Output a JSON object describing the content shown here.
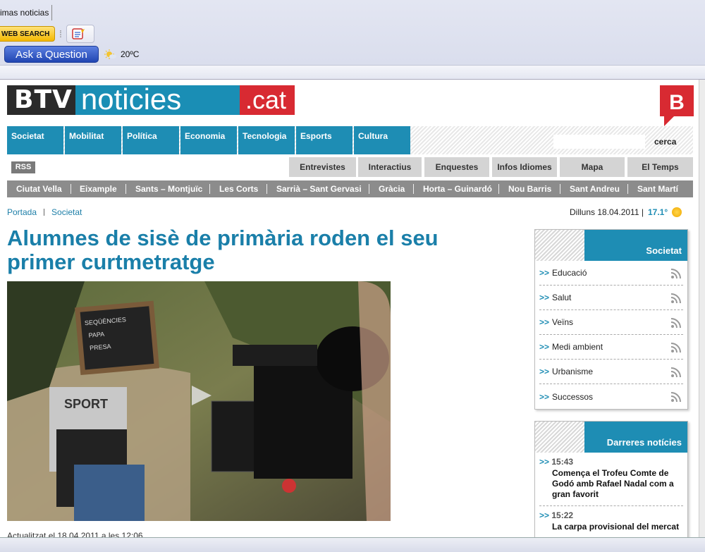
{
  "chrome": {
    "tab_label": "imas noticias",
    "web_search_label": "WEB SEARCH",
    "ask_label": "Ask a Question",
    "weather": "20ºC"
  },
  "header": {
    "logo_btv": "BTV",
    "logo_noticies": "noticies",
    "logo_cat": ".cat",
    "b_logo": "B"
  },
  "nav": {
    "items": [
      "Societat",
      "Mobilitat",
      "Política",
      "Economia",
      "Tecnologia",
      "Esports",
      "Cultura"
    ],
    "search_label": "cerca"
  },
  "subnav": {
    "rss": "RSS",
    "items": [
      "Entrevistes",
      "Interactius",
      "Enquestes",
      "Infos Idiomes",
      "Mapa",
      "El Temps"
    ]
  },
  "districts": [
    "Ciutat Vella",
    "Eixample",
    "Sants – Montjuïc",
    "Les Corts",
    "Sarrià – Sant Gervasi",
    "Gràcia",
    "Horta – Guinardó",
    "Nou Barris",
    "Sant Andreu",
    "Sant Martí"
  ],
  "breadcrumb": {
    "home": "Portada",
    "section": "Societat"
  },
  "dateline": {
    "date": "Dilluns 18.04.2011 |",
    "temp": "17.1°"
  },
  "article": {
    "headline": "Alumnes de sisè de primària roden el seu primer curtmetratge",
    "slate_text_1": "SEQÜÈNCIES",
    "slate_text_2": "PAPA",
    "slate_text_3": "PRESA",
    "shirt_text": "SPORT",
    "updated": "Actualitzat el 18.04.2011 a les 12:06"
  },
  "sidebar_societat": {
    "title": "Societat",
    "items": [
      "Educació",
      "Salut",
      "Veïns",
      "Medi ambient",
      "Urbanisme",
      "Successos"
    ]
  },
  "sidebar_news": {
    "title": "Darreres notícies",
    "items": [
      {
        "time": "15:43",
        "title": "Comença el Trofeu Comte de Godó amb Rafael Nadal com a gran favorit"
      },
      {
        "time": "15:22",
        "title": "La carpa provisional del mercat"
      }
    ]
  },
  "arrow": ">>"
}
